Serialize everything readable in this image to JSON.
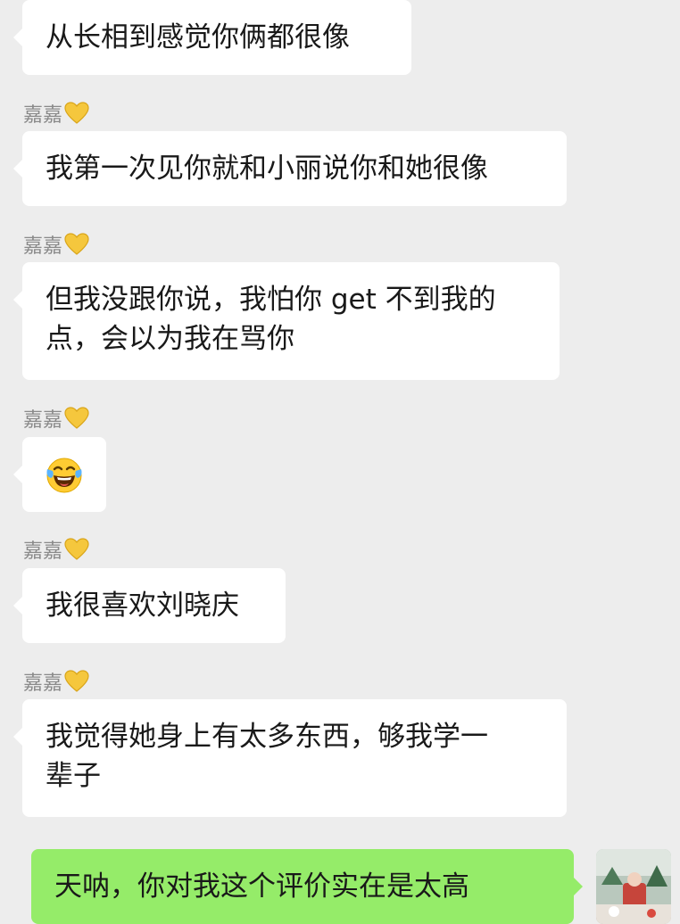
{
  "messages": [
    {
      "sender": "",
      "text": "从长相到感觉你俩都很像"
    },
    {
      "sender": "嘉嘉",
      "text": "我第一次见你就和小丽说你和她很像"
    },
    {
      "sender": "嘉嘉",
      "text": "但我没跟你说，我怕你 get 不到我的\n点，会以为我在骂你"
    },
    {
      "sender": "嘉嘉",
      "emoji": "laughing-tears-emoji"
    },
    {
      "sender": "嘉嘉",
      "text": "我很喜欢刘晓庆"
    },
    {
      "sender": "嘉嘉",
      "text": "我觉得她身上有太多东西，够我学一\n辈子"
    },
    {
      "sender": "me",
      "text": "天呐，你对我这个评价实在是太高"
    }
  ],
  "colors": {
    "background": "#ededed",
    "incoming_bubble": "#ffffff",
    "outgoing_bubble": "#95ec69",
    "sender_name": "#8a8a8a",
    "message_text": "#191919"
  }
}
